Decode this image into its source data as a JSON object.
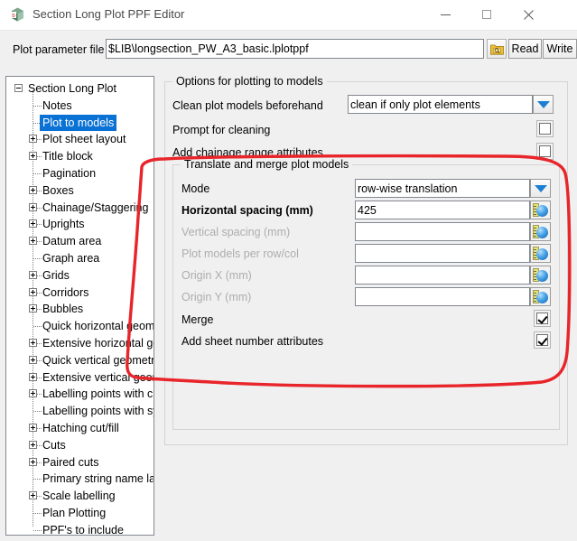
{
  "window": {
    "title": "Section Long Plot PPF Editor",
    "icon": "app-cube-icon",
    "minimize_glyph": "─",
    "maximize_glyph": "□",
    "close_glyph": "✕"
  },
  "param_row": {
    "label": "Plot parameter file",
    "value": "$LIB\\longsection_PW_A3_basic.lplotppf",
    "placeholder": "",
    "browse_icon": "folder-search-icon",
    "read_label": "Read",
    "write_label": "Write"
  },
  "tree": {
    "selected": "Plot to models",
    "items": [
      {
        "label": "Section Long Plot",
        "level": 0,
        "expander": "minus"
      },
      {
        "label": "Notes",
        "level": 1,
        "expander": "none"
      },
      {
        "label": "Plot to models",
        "level": 1,
        "expander": "none",
        "selected": true
      },
      {
        "label": "Plot sheet layout",
        "level": 1,
        "expander": "plus"
      },
      {
        "label": "Title block",
        "level": 1,
        "expander": "plus"
      },
      {
        "label": "Pagination",
        "level": 1,
        "expander": "none"
      },
      {
        "label": "Boxes",
        "level": 1,
        "expander": "plus"
      },
      {
        "label": "Chainage/Staggering",
        "level": 1,
        "expander": "plus"
      },
      {
        "label": "Uprights",
        "level": 1,
        "expander": "plus"
      },
      {
        "label": "Datum area",
        "level": 1,
        "expander": "plus"
      },
      {
        "label": "Graph area",
        "level": 1,
        "expander": "none"
      },
      {
        "label": "Grids",
        "level": 1,
        "expander": "plus"
      },
      {
        "label": "Corridors",
        "level": 1,
        "expander": "plus"
      },
      {
        "label": "Bubbles",
        "level": 1,
        "expander": "plus"
      },
      {
        "label": "Quick horizontal geometry",
        "level": 1,
        "expander": "none"
      },
      {
        "label": "Extensive horizontal geometry",
        "level": 1,
        "expander": "plus"
      },
      {
        "label": "Quick vertical geometry",
        "level": 1,
        "expander": "plus"
      },
      {
        "label": "Extensive vertical geometry",
        "level": 1,
        "expander": "plus"
      },
      {
        "label": "Labelling points with clearances",
        "level": 1,
        "expander": "plus"
      },
      {
        "label": "Labelling points with symbols",
        "level": 1,
        "expander": "none"
      },
      {
        "label": "Hatching cut/fill",
        "level": 1,
        "expander": "plus"
      },
      {
        "label": "Cuts",
        "level": 1,
        "expander": "plus"
      },
      {
        "label": "Paired cuts",
        "level": 1,
        "expander": "plus"
      },
      {
        "label": "Primary string name labels",
        "level": 1,
        "expander": "none"
      },
      {
        "label": "Scale labelling",
        "level": 1,
        "expander": "plus"
      },
      {
        "label": "Plan Plotting",
        "level": 1,
        "expander": "none"
      },
      {
        "label": "PPF's to include",
        "level": 1,
        "expander": "none"
      }
    ]
  },
  "options_group": {
    "title": "Options for plotting to models",
    "clean_label": "Clean plot models beforehand",
    "clean_value": "clean if only plot elements",
    "prompt_label": "Prompt for cleaning",
    "prompt_checked": false,
    "chainage_label": "Add chainage range attributes",
    "chainage_checked": false
  },
  "translate_group": {
    "title": "Translate and merge plot models",
    "mode_label": "Mode",
    "mode_value": "row-wise translation",
    "hspacing_label": "Horizontal spacing (mm)",
    "hspacing_value": "425",
    "vspacing_label": "Vertical spacing (mm)",
    "vspacing_value": "",
    "permodels_label": "Plot models per row/col",
    "permodels_value": "",
    "originx_label": "Origin X (mm)",
    "originx_value": "",
    "originy_label": "Origin Y (mm)",
    "originy_value": "",
    "merge_label": "Merge",
    "merge_checked": true,
    "sheetnum_label": "Add sheet number attributes",
    "sheetnum_checked": true
  },
  "annotation": {
    "color": "#e8252a",
    "shape": "hand-drawn-rounded-rectangle"
  }
}
